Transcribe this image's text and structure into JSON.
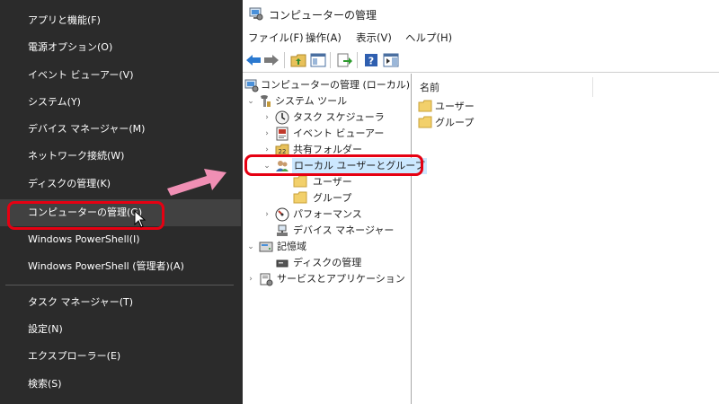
{
  "winx_menu": {
    "items": [
      {
        "label": "アプリと機能(F)"
      },
      {
        "label": "電源オプション(O)"
      },
      {
        "label": "イベント ビューアー(V)"
      },
      {
        "label": "システム(Y)"
      },
      {
        "label": "デバイス マネージャー(M)"
      },
      {
        "label": "ネットワーク接続(W)"
      },
      {
        "label": "ディスクの管理(K)"
      },
      {
        "label": "コンピューターの管理(G)"
      },
      {
        "label": "Windows PowerShell(I)"
      },
      {
        "label": "Windows PowerShell (管理者)(A)"
      },
      {
        "label": "タスク マネージャー(T)"
      },
      {
        "label": "設定(N)"
      },
      {
        "label": "エクスプローラー(E)"
      },
      {
        "label": "検索(S)"
      }
    ],
    "hovered_item": "コンピューターの管理(G)"
  },
  "window": {
    "title": "コンピューターの管理",
    "menu": {
      "file": "ファイル(F)",
      "action": "操作(A)",
      "view": "表示(V)",
      "help": "ヘルプ(H)"
    },
    "toolbar_icons": [
      "back-arrow-icon",
      "forward-arrow-icon",
      "up-folder-icon",
      "console-tree-icon",
      "export-list-icon",
      "help-icon",
      "action-pane-icon"
    ],
    "tree": {
      "root": "コンピューターの管理 (ローカル)",
      "system_tools": "システム ツール",
      "task_scheduler": "タスク スケジューラ",
      "event_viewer": "イベント ビューアー",
      "shared_folders": "共有フォルダー",
      "local_users_groups": "ローカル ユーザーとグループ",
      "users": "ユーザー",
      "groups": "グループ",
      "performance": "パフォーマンス",
      "device_manager": "デバイス マネージャー",
      "storage": "記憶域",
      "disk_management": "ディスクの管理",
      "services_apps": "サービスとアプリケーション"
    },
    "list": {
      "column_name": "名前",
      "items": [
        {
          "label": "ユーザー"
        },
        {
          "label": "グループ"
        }
      ]
    }
  },
  "colors": {
    "menu_bg": "#2b2b2b",
    "menu_hover": "#414141",
    "highlight_red": "#e60012",
    "arrow_pink": "#f08fb4",
    "selection_blue": "#cce8ff"
  }
}
